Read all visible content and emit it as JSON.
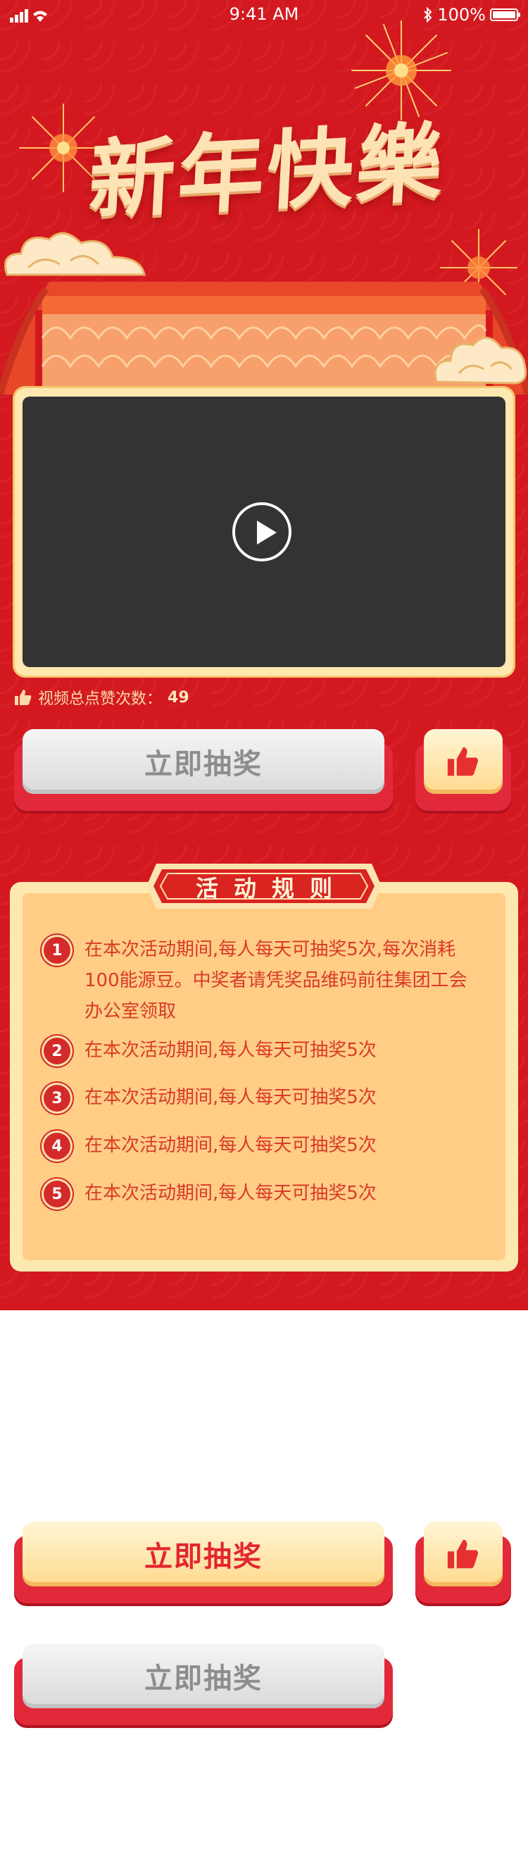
{
  "status_bar": {
    "time": "9:41 AM",
    "battery": "100%"
  },
  "header": {
    "title": "新年快樂"
  },
  "video": {
    "likes_label": "视频总点赞次数：",
    "likes_count": "49"
  },
  "draw_button": {
    "label": "立即抽奖"
  },
  "rules": {
    "title": "活动规则",
    "items": [
      {
        "num": "1",
        "text": "在本次活动期间,每人每天可抽奖5次,每次消耗100能源豆。中奖者请凭奖品维码前往集团工会办公室领取"
      },
      {
        "num": "2",
        "text": "在本次活动期间,每人每天可抽奖5次"
      },
      {
        "num": "3",
        "text": "在本次活动期间,每人每天可抽奖5次"
      },
      {
        "num": "4",
        "text": "在本次活动期间,每人每天可抽奖5次"
      },
      {
        "num": "5",
        "text": "在本次活动期间,每人每天可抽奖5次"
      }
    ]
  },
  "states": {
    "active_button": {
      "label": "立即抽奖"
    },
    "disabled_button": {
      "label": "立即抽奖"
    }
  },
  "icons": [
    "signal-icon",
    "wifi-icon",
    "bluetooth-icon",
    "battery-icon",
    "play-icon",
    "thumbs-up-icon"
  ],
  "colors": {
    "primary_red": "#d3191f",
    "gold": "#ffd98c",
    "cream": "#fde9b0",
    "text_red": "#d83a2a"
  }
}
